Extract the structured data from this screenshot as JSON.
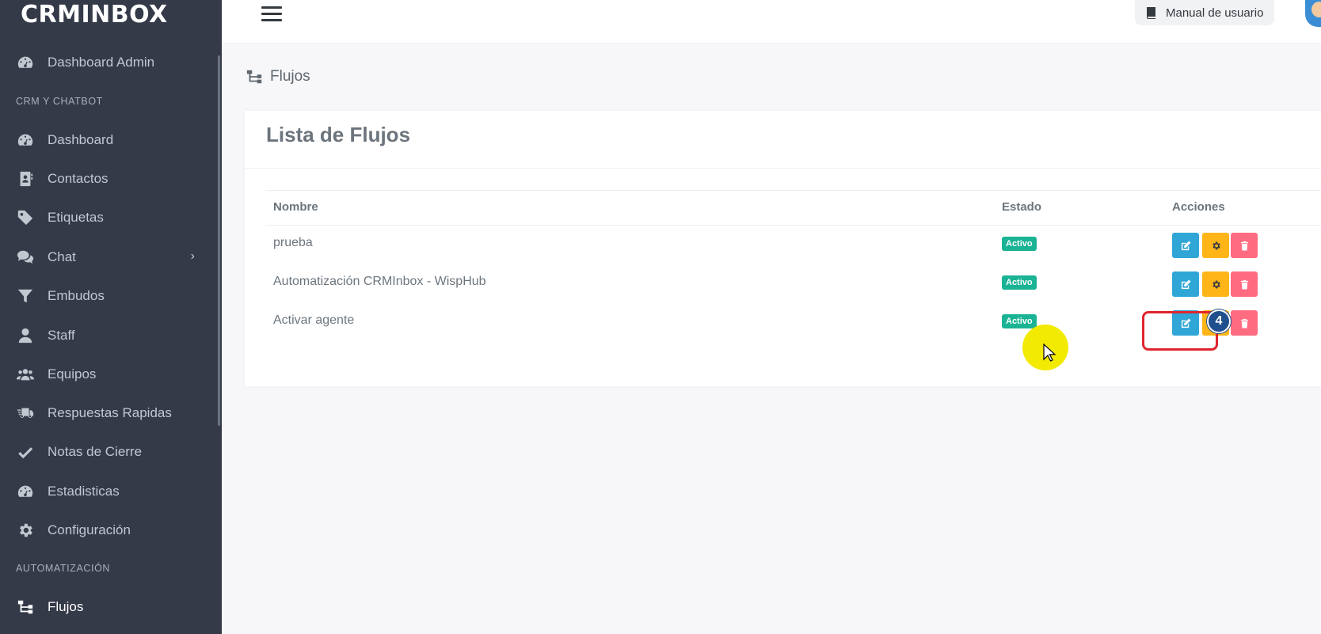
{
  "brand": {
    "logo_text": "CRMINBOX"
  },
  "sidebar": {
    "items": [
      {
        "label": "Dashboard Admin",
        "icon": "tachometer-icon"
      },
      {
        "label": "Dashboard",
        "icon": "tachometer-icon"
      },
      {
        "label": "Contactos",
        "icon": "address-book-icon"
      },
      {
        "label": "Etiquetas",
        "icon": "tag-icon"
      },
      {
        "label": "Chat",
        "icon": "comments-icon",
        "has_submenu": true
      },
      {
        "label": "Embudos",
        "icon": "filter-icon"
      },
      {
        "label": "Staff",
        "icon": "user-icon"
      },
      {
        "label": "Equipos",
        "icon": "users-icon"
      },
      {
        "label": "Respuestas Rapidas",
        "icon": "truck-fast-icon"
      },
      {
        "label": "Notas de Cierre",
        "icon": "check-icon"
      },
      {
        "label": "Estadisticas",
        "icon": "tachometer-icon"
      },
      {
        "label": "Configuración",
        "icon": "gear-icon"
      },
      {
        "label": "Flujos",
        "icon": "sitemap-icon",
        "active": true
      }
    ],
    "headers": [
      "CRM Y CHATBOT",
      "AUTOMATIZACIÓN"
    ]
  },
  "topbar": {
    "manual_label": "Manual de usuario"
  },
  "breadcrumb": {
    "title": "Flujos"
  },
  "card": {
    "title": "Lista de Flujos"
  },
  "table": {
    "columns": [
      "Nombre",
      "Estado",
      "Acciones"
    ],
    "rows": [
      {
        "nombre": "prueba",
        "estado": "Activo"
      },
      {
        "nombre": "Automatización CRMInbox - WispHub",
        "estado": "Activo"
      },
      {
        "nombre": "Activar agente",
        "estado": "Activo"
      }
    ]
  },
  "annotation": {
    "step_number": "4"
  },
  "colors": {
    "sidebar_bg": "#343a48",
    "badge_active": "#1ab394",
    "btn_edit": "#2fa6d6",
    "btn_config": "#ffb518",
    "btn_delete": "#ff6b81",
    "highlight_border": "#e0252e",
    "step_badge": "#1f4f8c"
  }
}
